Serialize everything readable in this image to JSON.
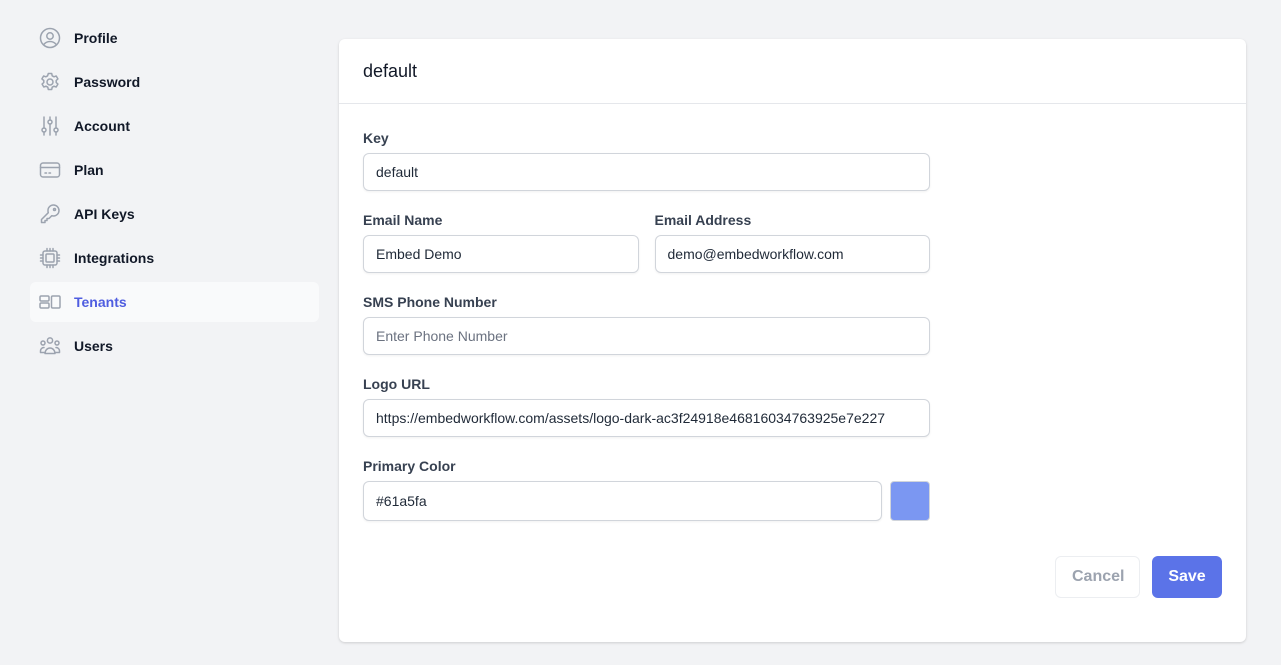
{
  "sidebar": {
    "items": [
      {
        "label": "Profile",
        "icon": "user-circle-icon",
        "active": false
      },
      {
        "label": "Password",
        "icon": "gear-icon",
        "active": false
      },
      {
        "label": "Account",
        "icon": "sliders-icon",
        "active": false
      },
      {
        "label": "Plan",
        "icon": "credit-card-icon",
        "active": false
      },
      {
        "label": "API Keys",
        "icon": "key-icon",
        "active": false
      },
      {
        "label": "Integrations",
        "icon": "chip-icon",
        "active": false
      },
      {
        "label": "Tenants",
        "icon": "layout-icon",
        "active": true
      },
      {
        "label": "Users",
        "icon": "users-icon",
        "active": false
      }
    ]
  },
  "card": {
    "title": "default"
  },
  "form": {
    "key": {
      "label": "Key",
      "value": "default"
    },
    "email_name": {
      "label": "Email Name",
      "value": "Embed Demo"
    },
    "email_address": {
      "label": "Email Address",
      "value": "demo@embedworkflow.com"
    },
    "sms_phone": {
      "label": "SMS Phone Number",
      "value": "",
      "placeholder": "Enter Phone Number"
    },
    "logo_url": {
      "label": "Logo URL",
      "value": "https://embedworkflow.com/assets/logo-dark-ac3f24918e46816034763925e7e227"
    },
    "primary_color": {
      "label": "Primary Color",
      "value": "#61a5fa",
      "swatch_color": "#7b97f2"
    }
  },
  "actions": {
    "cancel_label": "Cancel",
    "save_label": "Save"
  },
  "colors": {
    "accent": "#5b73e8",
    "active_nav_text": "#4f5de0",
    "background": "#f2f3f5"
  }
}
